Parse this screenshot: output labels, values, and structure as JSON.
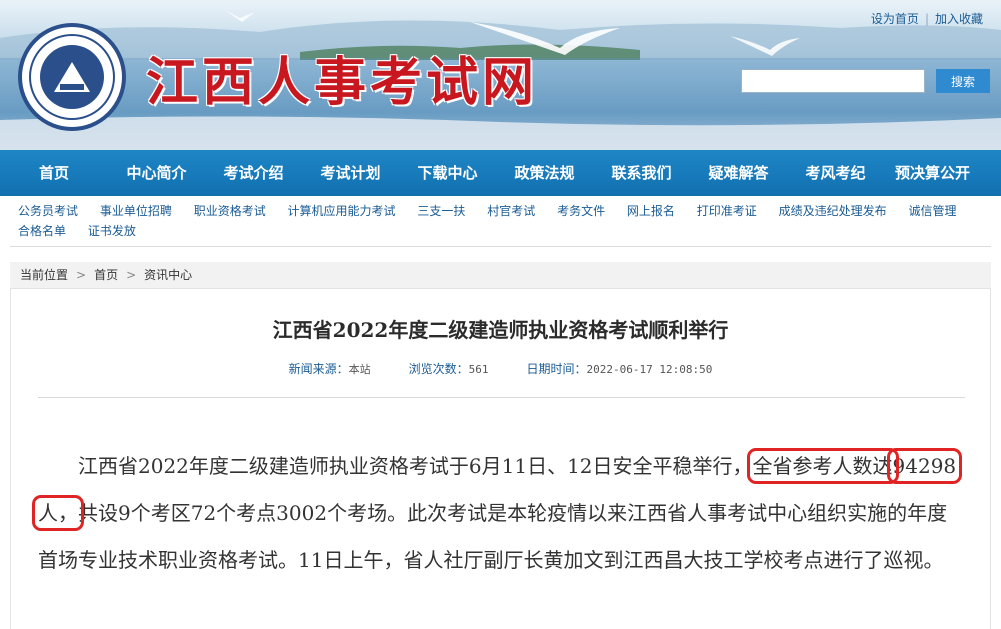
{
  "header": {
    "site_title": "江西人事考试网",
    "top_links": [
      "设为首页",
      "加入收藏"
    ],
    "search_button": "搜索",
    "search_value": ""
  },
  "main_nav": [
    "首页",
    "中心简介",
    "考试介绍",
    "考试计划",
    "下载中心",
    "政策法规",
    "联系我们",
    "疑难解答",
    "考风考纪",
    "预决算公开"
  ],
  "sub_nav": [
    "公务员考试",
    "事业单位招聘",
    "职业资格考试",
    "计算机应用能力考试",
    "三支一扶",
    "村官考试",
    "考务文件",
    "网上报名",
    "打印准考证",
    "成绩及违纪处理发布",
    "诚信管理",
    "合格名单",
    "证书发放"
  ],
  "breadcrumb": {
    "label": "当前位置",
    "items": [
      "首页",
      "资讯中心"
    ]
  },
  "article": {
    "title": "江西省2022年度二级建造师执业资格考试顺利举行",
    "meta": {
      "source_label": "新闻来源：",
      "source_value": "本站",
      "views_label": "浏览次数：",
      "views_value": "561",
      "date_label": "日期时间：",
      "date_value": "2022-06-17 12:08:50"
    },
    "body_part1": "江西省2022年度二级建造师执业资格考试于6月11日、12日安全平稳举行，",
    "highlight1": "全省参考人数达",
    "highlight2": "94298人，",
    "body_part2": "共设9个考区72个考点3002个考场。此次考试是本轮疫情以来江西省人事考试中心组织实施的年度首场专业技术职业资格考试。11日上午，省人社厅副厅长黄加文到江西昌大技工学校考点进行了巡视。"
  },
  "colors": {
    "nav_blue": "#1170b0",
    "title_red": "#c8171e",
    "link_blue": "#1a5b94",
    "highlight_red": "#e02424"
  }
}
